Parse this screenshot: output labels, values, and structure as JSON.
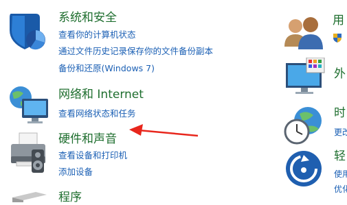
{
  "categories_left": [
    {
      "title": "系统和安全",
      "links": [
        "查看你的计算机状态",
        "通过文件历史记录保存你的文件备份副本",
        "备份和还原(Windows 7)"
      ]
    },
    {
      "title": "网络和 Internet",
      "links": [
        "查看网络状态和任务"
      ]
    },
    {
      "title": "硬件和声音",
      "links": [
        "查看设备和打印机",
        "添加设备"
      ]
    },
    {
      "title": "程序",
      "links": []
    }
  ],
  "categories_right": [
    {
      "title": "用",
      "links": []
    },
    {
      "title": "外",
      "links": []
    },
    {
      "title": "时",
      "links": [
        "更改"
      ]
    },
    {
      "title": "轻",
      "links": [
        "使用",
        "优化"
      ]
    }
  ],
  "colors": {
    "title_green": "#1e6e2e",
    "link_blue": "#1a5fb4",
    "arrow_red": "#e8261c"
  }
}
